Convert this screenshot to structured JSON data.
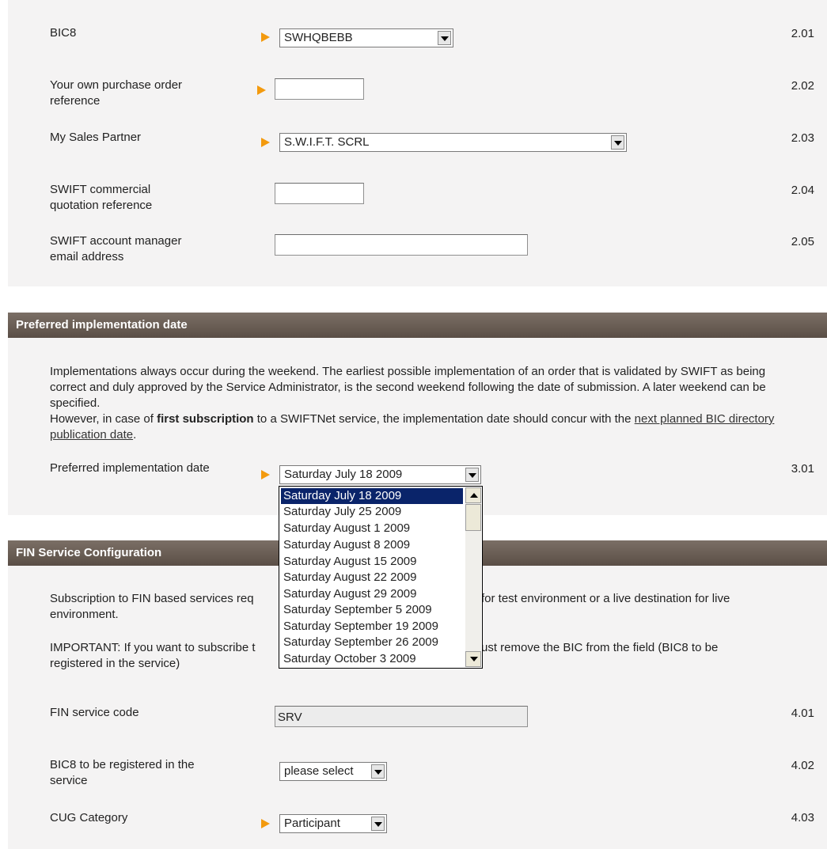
{
  "account": {
    "fields": [
      {
        "label": "BIC8",
        "value": "SWHQBEBB",
        "number": "2.01"
      },
      {
        "label": "Your own purchase order reference",
        "value": "",
        "number": "2.02"
      },
      {
        "label": "My Sales Partner",
        "value": "S.W.I.F.T. SCRL",
        "number": "2.03"
      },
      {
        "label": "SWIFT commercial quotation reference",
        "value": "",
        "number": "2.04"
      },
      {
        "label": "SWIFT account manager email address",
        "value": "",
        "number": "2.05"
      }
    ]
  },
  "implementation": {
    "header": "Preferred implementation date",
    "para1": "Implementations always occur during the weekend. The earliest possible implementation of an order that is validated by SWIFT as being correct and duly approved by the Service Administrator, is the second weekend following the date of submission. A later weekend can be specified.",
    "para2_prefix": "However, in case of ",
    "para2_bold": "first subscription",
    "para2_mid": " to a SWIFTNet service, the implementation date should concur with the ",
    "para2_link": "next planned BIC directory publication date",
    "para2_suffix": ".",
    "date_label": "Preferred implementation date",
    "date_value": "Saturday July 18 2009",
    "date_number": "3.01",
    "date_options": [
      "Saturday July 18 2009",
      "Saturday July 25 2009",
      "Saturday August 1 2009",
      "Saturday August 8 2009",
      "Saturday August 15 2009",
      "Saturday August 22 2009",
      "Saturday August 29 2009",
      "Saturday September 5 2009",
      "Saturday September 19 2009",
      "Saturday September 26 2009",
      "Saturday October 3 2009"
    ]
  },
  "fin": {
    "header": "FIN Service Configuration",
    "para1_left": "Subscription to FIN based services req",
    "para1_right": "for test environment or a live destination for live",
    "para1_line2": "environment.",
    "para2_left": "IMPORTANT: If you want to subscribe t",
    "para2_right": "ust remove the BIC from the field (BIC8 to be",
    "para2_line2": "registered in the service)",
    "fields": [
      {
        "label": "FIN service code",
        "value": "SRV",
        "number": "4.01"
      },
      {
        "label": "BIC8 to be registered in the service",
        "value": "please select",
        "number": "4.02"
      },
      {
        "label": "CUG Category",
        "value": "Participant",
        "number": "4.03"
      }
    ]
  },
  "colors": {
    "header_bg": "#6b5f56",
    "arrow": "#f39a0e",
    "selected_option_bg": "#0a246a",
    "panel_bg": "#f4f3f3"
  }
}
